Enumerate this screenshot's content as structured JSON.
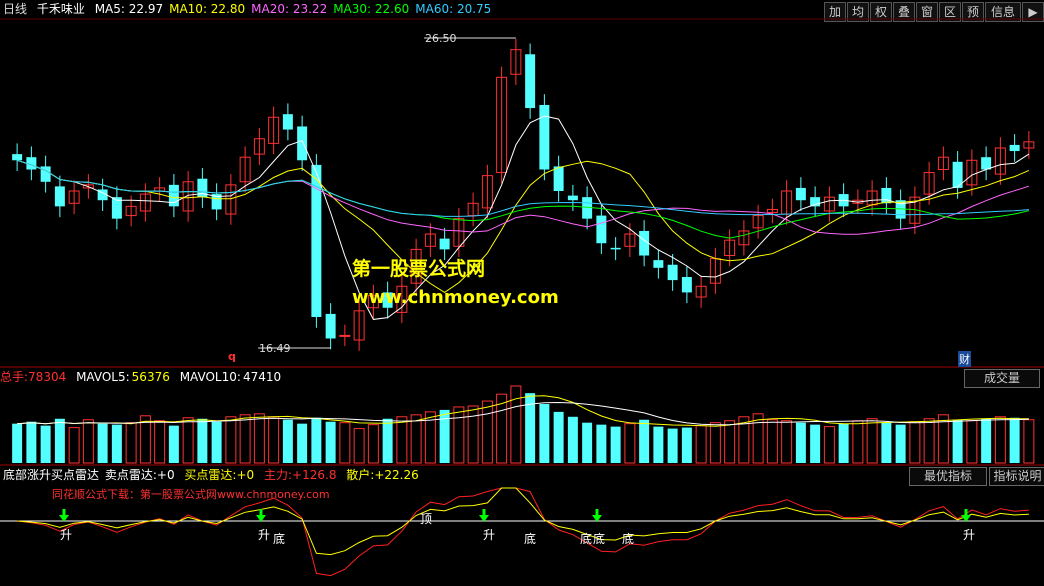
{
  "header": {
    "period": "日线",
    "stock": "千禾味业",
    "ma": [
      {
        "label": "MA5:",
        "value": "22.97",
        "color": "#ffffff"
      },
      {
        "label": "MA10:",
        "value": "22.80",
        "color": "#ffff00"
      },
      {
        "label": "MA20:",
        "value": "23.22",
        "color": "#ff66ff"
      },
      {
        "label": "MA30:",
        "value": "22.60",
        "color": "#00ff00"
      },
      {
        "label": "MA60:",
        "value": "20.75",
        "color": "#33ccff"
      }
    ]
  },
  "toolbar": [
    "加",
    "均",
    "权",
    "叠",
    "窗",
    "区",
    "预",
    "信息"
  ],
  "volume_header": {
    "label": "总手:",
    "value": "78304",
    "mavol5_label": "MAVOL5:",
    "mavol5": "56376",
    "mavol10_label": "MAVOL10:",
    "mavol10": "47410"
  },
  "volume_button": "成交量",
  "indicator_header": {
    "name": "底部涨升买点雷达",
    "sell_label": "卖点雷达:",
    "sell": "+0",
    "buy_label": "买点雷达:",
    "buy": "+0",
    "main_label": "主力:",
    "main": "+126.8",
    "retail_label": "散户:",
    "retail": "+22.26"
  },
  "indicator_buttons": [
    "最优指标",
    "指标说明"
  ],
  "annotations": {
    "high": "26.50",
    "low": "16.49",
    "q_marker": "q",
    "cai_marker": "财",
    "ding": "顶"
  },
  "watermark": {
    "line1": "第一股票公式网",
    "line2": "www.chnmoney.com"
  },
  "download_note": "同花顺公式下载：第一股票公式网www.chnmoney.com",
  "signals": {
    "sheng": "升",
    "di": "底"
  },
  "colors": {
    "up": "#ff3232",
    "down": "#54ffff",
    "ma5": "#ffffff",
    "ma10": "#ffff00",
    "ma20": "#ff66ff",
    "ma30": "#00ff00",
    "ma60": "#33ccff"
  },
  "chart_data": {
    "type": "candlestick",
    "price_range": [
      16.0,
      27.0
    ],
    "close": [
      22.5,
      22.2,
      21.8,
      21.0,
      21.5,
      21.7,
      21.2,
      20.6,
      21.0,
      21.4,
      21.6,
      21.0,
      21.8,
      21.3,
      20.9,
      21.7,
      22.6,
      23.2,
      23.9,
      23.5,
      22.5,
      17.4,
      16.7,
      16.8,
      17.6,
      18.1,
      17.7,
      18.4,
      19.6,
      20.1,
      19.6,
      20.6,
      21.1,
      22.0,
      25.2,
      26.1,
      24.2,
      22.2,
      21.5,
      21.2,
      20.6,
      19.8,
      19.6,
      20.1,
      19.4,
      19.0,
      18.6,
      18.2,
      18.4,
      19.3,
      19.9,
      20.2,
      20.7,
      20.9,
      21.5,
      21.2,
      21.0,
      21.3,
      21.0,
      21.2,
      21.5,
      21.1,
      20.6,
      21.3,
      22.1,
      22.6,
      21.6,
      22.5,
      22.2,
      22.9,
      22.8,
      23.1
    ],
    "volume": [
      40000,
      42000,
      38000,
      45000,
      36000,
      44000,
      40000,
      39000,
      41000,
      48000,
      43000,
      38000,
      46000,
      45000,
      42000,
      47000,
      49000,
      50000,
      47000,
      44000,
      40000,
      46000,
      42000,
      41000,
      35000,
      39000,
      45000,
      47000,
      49000,
      52000,
      54000,
      57000,
      58000,
      63000,
      70000,
      78304,
      71000,
      60000,
      52000,
      47000,
      41000,
      39000,
      37000,
      40000,
      44000,
      37000,
      35000,
      36000,
      38000,
      41000,
      43000,
      47000,
      50000,
      44000,
      43000,
      41000,
      39000,
      37000,
      40000,
      43000,
      45000,
      41000,
      39000,
      42000,
      45000,
      49000,
      44000,
      43000,
      45000,
      47000,
      46000,
      44000
    ]
  }
}
